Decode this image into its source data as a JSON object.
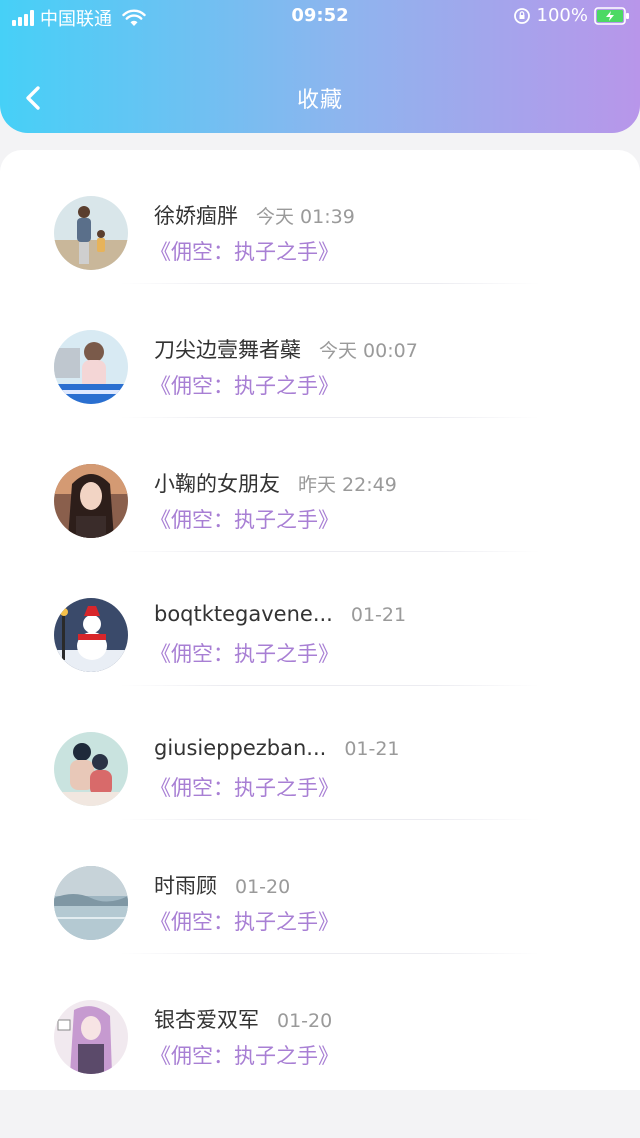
{
  "status_bar": {
    "carrier": "中国联通",
    "time": "09:52",
    "battery": "100%"
  },
  "header": {
    "title": "收藏",
    "back_icon": "chevron-left-icon"
  },
  "colors": {
    "header_gradient": [
      "#46d0f7",
      "#8fb4ee",
      "#b896ea"
    ],
    "work_text": "#a87fd4",
    "name_text": "#333333",
    "time_text": "#9a9a9a"
  },
  "favorites": [
    {
      "name": "徐娇痼胖",
      "time": "今天 01:39",
      "work": "《佣空：执子之手》"
    },
    {
      "name": "刀尖边壹舞者蘗",
      "time": "今天 00:07",
      "work": "《佣空：执子之手》"
    },
    {
      "name": "小鞠的女朋友",
      "time": "昨天 22:49",
      "work": "《佣空：执子之手》"
    },
    {
      "name": "boqtktegavene...",
      "time": "01-21",
      "work": "《佣空：执子之手》"
    },
    {
      "name": "giusieppezban...",
      "time": "01-21",
      "work": "《佣空：执子之手》"
    },
    {
      "name": "时雨顾",
      "time": "01-20",
      "work": "《佣空：执子之手》"
    },
    {
      "name": "银杏爱双军",
      "time": "01-20",
      "work": "《佣空：执子之手》"
    }
  ]
}
